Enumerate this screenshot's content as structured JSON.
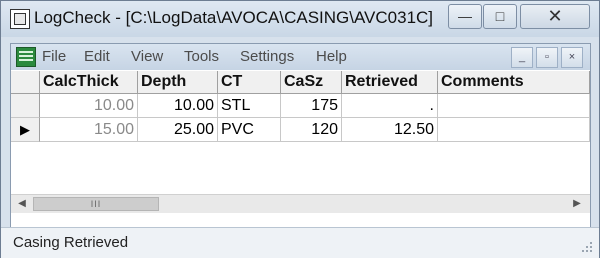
{
  "window": {
    "title": "LogCheck - [C:\\LogData\\AVOCA\\CASING\\AVC031C]",
    "caption_buttons": {
      "minimize": "—",
      "maximize": "□",
      "close": "✕"
    }
  },
  "menu": {
    "items": [
      "File",
      "Edit",
      "View",
      "Tools",
      "Settings",
      "Help"
    ],
    "mdi_buttons": {
      "minimize": "_",
      "restore": "▫",
      "close": "×"
    }
  },
  "grid": {
    "columns": [
      "CalcThick",
      "Depth",
      "CT",
      "CaSz",
      "Retrieved",
      "Comments"
    ],
    "rows": [
      {
        "indicator": "",
        "cells": [
          "10.00",
          "10.00",
          "STL",
          "175",
          ".",
          ""
        ]
      },
      {
        "indicator": "▶",
        "cells": [
          "15.00",
          "25.00",
          "PVC",
          "120",
          "12.50",
          ""
        ]
      }
    ]
  },
  "scrollbar": {
    "left_arrow": "◀",
    "right_arrow": "▶",
    "thumb_glyph": "III"
  },
  "status": {
    "text": "Casing Retrieved"
  }
}
